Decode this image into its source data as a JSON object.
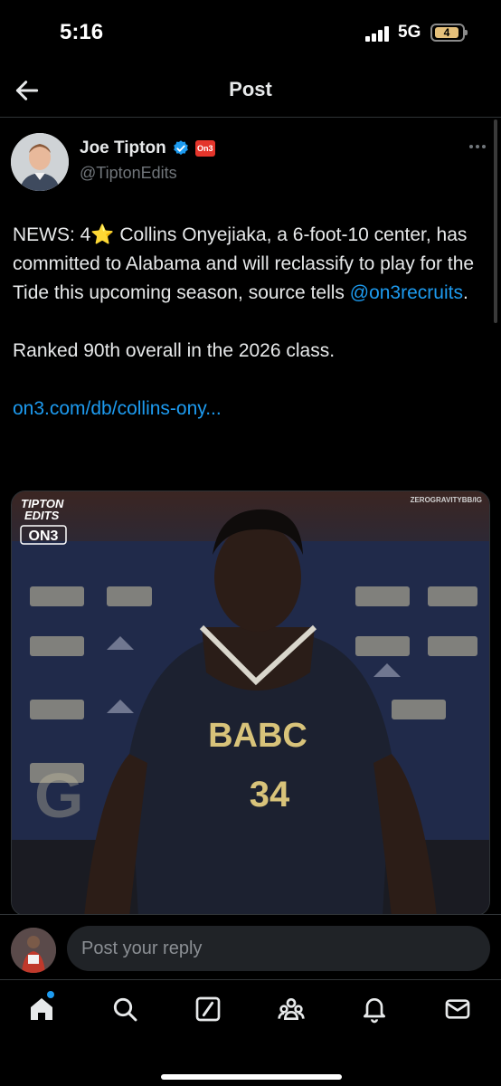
{
  "status_bar": {
    "time": "5:16",
    "network": "5G",
    "battery": "4"
  },
  "nav": {
    "title": "Post",
    "back_icon": "arrow-left-icon"
  },
  "author": {
    "name": "Joe Tipton",
    "handle": "@TiptonEdits",
    "affiliate_badge": "On3",
    "verified": true
  },
  "tweet": {
    "text_prefix": "NEWS: 4",
    "emoji": "⭐",
    "text_main": " Collins Onyejiaka, a 6-foot-10 center, has committed to Alabama and will reclassify to play for the Tide this upcoming season, source tells ",
    "mention": "@on3recruits",
    "mention_suffix": ".",
    "line2": "Ranked 90th overall in the 2026 class.",
    "link": "on3.com/db/collins-ony..."
  },
  "media": {
    "watermark_left_1": "TIPTON",
    "watermark_left_2": "EDITS",
    "watermark_logo": "ON3",
    "watermark_right": "ZEROGRAVITYBB/IG",
    "jersey_text": "BABC",
    "jersey_number": "34"
  },
  "reply": {
    "placeholder": "Post your reply"
  },
  "tabbar": {
    "items": [
      "home-icon",
      "search-icon",
      "compose-icon",
      "communities-icon",
      "notifications-icon",
      "messages-icon"
    ]
  },
  "colors": {
    "accent": "#1d9bf0",
    "background": "#000000",
    "text": "#e7e9ea",
    "muted": "#71767b"
  }
}
